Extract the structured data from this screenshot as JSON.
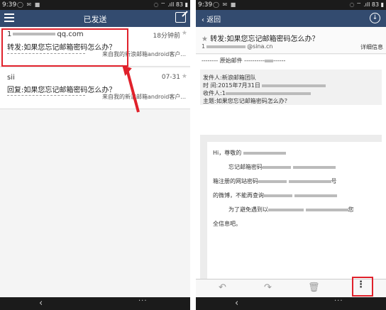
{
  "left": {
    "status": {
      "time": "9:39",
      "battery": "83"
    },
    "header": {
      "title": "已发送"
    },
    "emails": [
      {
        "sender": "1",
        "sender_domain": "qq.com",
        "time": "18分钟前",
        "subject": "转发:如果您忘记邮箱密码怎么办？",
        "preview": "来自我的新浪邮箱android客户..."
      },
      {
        "sender": "sii",
        "time": "07-31",
        "subject": "回复:如果您忘记邮箱密码怎么办？",
        "preview": "来自我的新浪邮箱android客户..."
      }
    ],
    "nav": {
      "back": "‹",
      "more": "···"
    }
  },
  "right": {
    "status": {
      "time": "9:39",
      "battery": "83"
    },
    "header": {
      "back_label": "返回"
    },
    "message": {
      "subject": "转发:如果您忘记邮箱密码怎么办？",
      "from_addr": "@sina.cn",
      "details_link": "详细信息"
    },
    "original": {
      "divider": "原始邮件",
      "from": "发件人:新浪邮箱团队",
      "date": "时  间:2015年7月31日",
      "to": "收件人:1",
      "subject": "主题:如果您忘记邮箱密码怎么办？"
    },
    "body": {
      "greeting": "Hi，尊敬的",
      "line1": "忘记邮箱密码",
      "line2": "箱注册的网站密码",
      "line2_suffix": "号",
      "line3": "的微博，不能再查询",
      "line4": "为了避免遇到以",
      "line4_suffix": "您",
      "line5": "全信息吧。"
    },
    "nav": {
      "back": "‹",
      "more": "···"
    }
  }
}
